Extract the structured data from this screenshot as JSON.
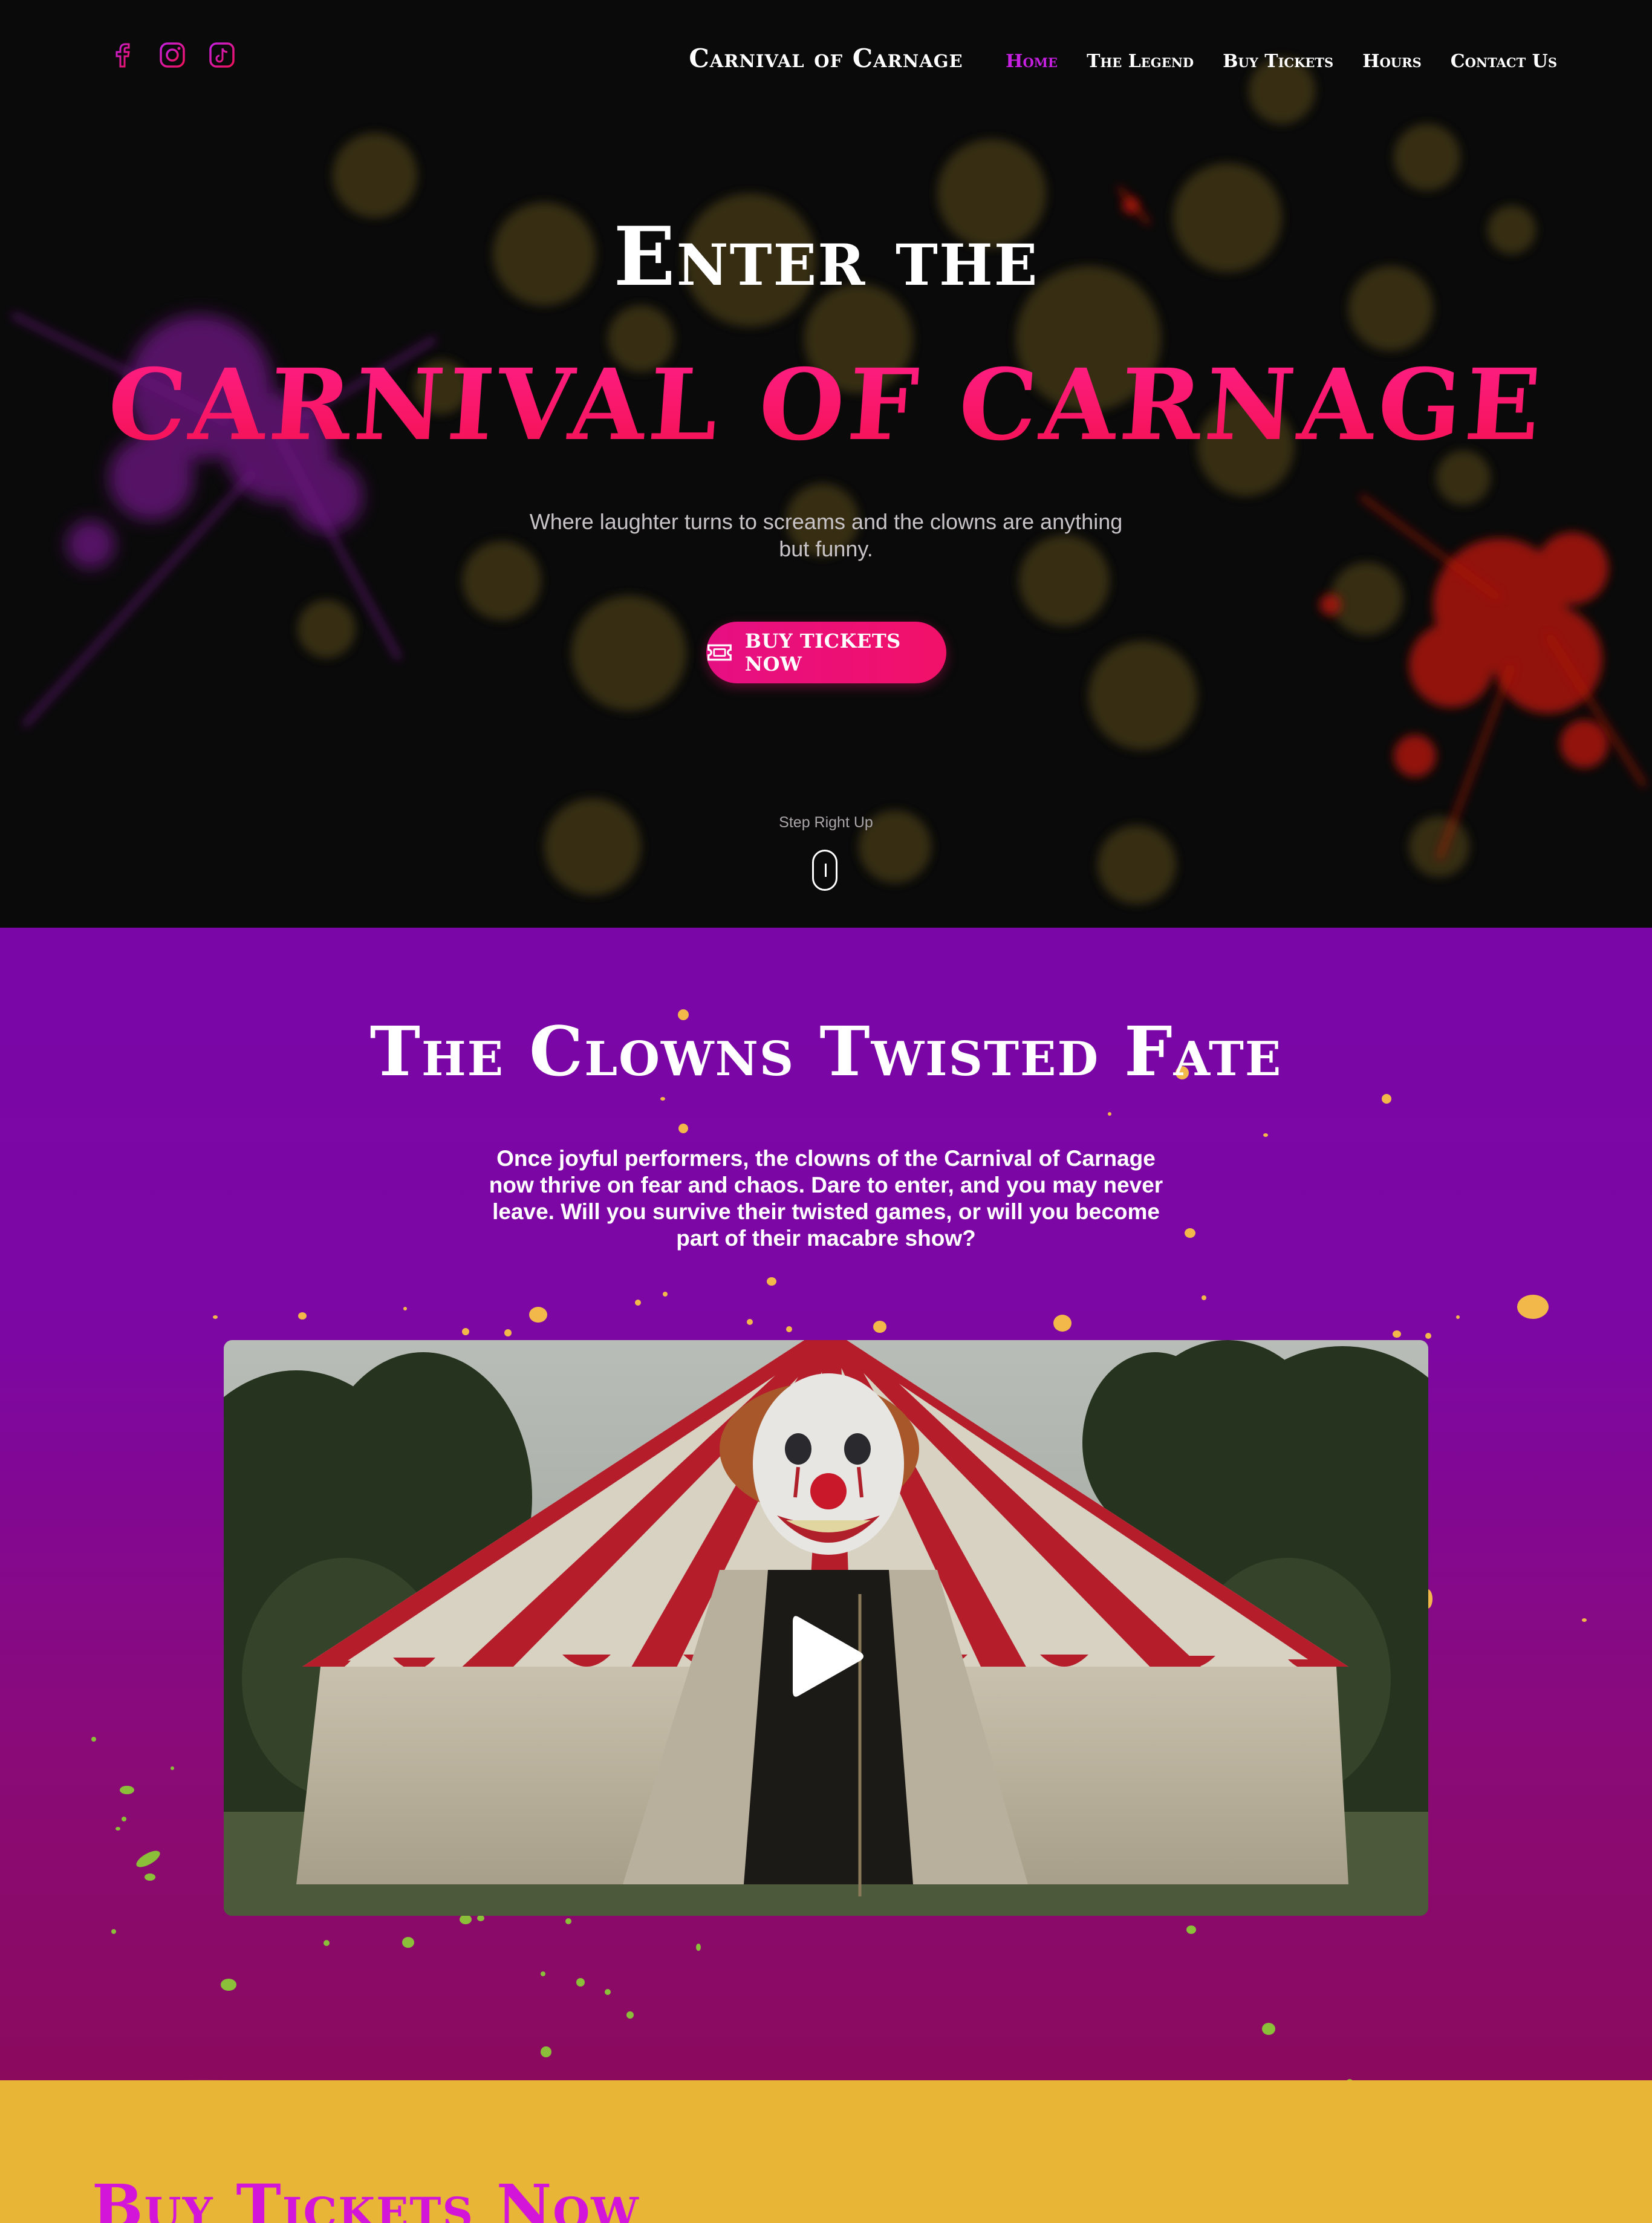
{
  "brand": {
    "site_title": "Carnival of Carnage",
    "colors": {
      "magenta": "#c51fe0",
      "hot_pink": "#f0125a",
      "purple": "#7a06a8",
      "gold": "#e8b537"
    }
  },
  "social": [
    {
      "name": "facebook-icon",
      "label": "Facebook"
    },
    {
      "name": "instagram-icon",
      "label": "Instagram"
    },
    {
      "name": "tiktok-icon",
      "label": "TikTok"
    }
  ],
  "nav": {
    "items": [
      {
        "label": "Home",
        "active": true
      },
      {
        "label": "The Legend"
      },
      {
        "label": "Buy Tickets"
      },
      {
        "label": "Hours"
      },
      {
        "label": "Contact Us"
      }
    ]
  },
  "hero": {
    "title_top": "Enter the",
    "title_main": "CARNIVAL OF CARNAGE",
    "subtitle": "Where laughter turns to screams and the clowns are anything but funny.",
    "cta_label": "BUY TICKETS NOW",
    "cta_icon": "ticket-icon",
    "scroll_label": "Step Right Up",
    "scroll_icon": "mouse-scroll-icon"
  },
  "story": {
    "title": "The Clowns Twisted Fate",
    "text": "Once joyful performers, the clowns of the Carnival of Carnage now thrive on fear and chaos. Dare to enter, and you may never leave. Will you survive their twisted games, or will you become part of their macabre show?",
    "video_icon": "play-icon"
  },
  "tickets": {
    "title": "Buy Tickets Now"
  }
}
